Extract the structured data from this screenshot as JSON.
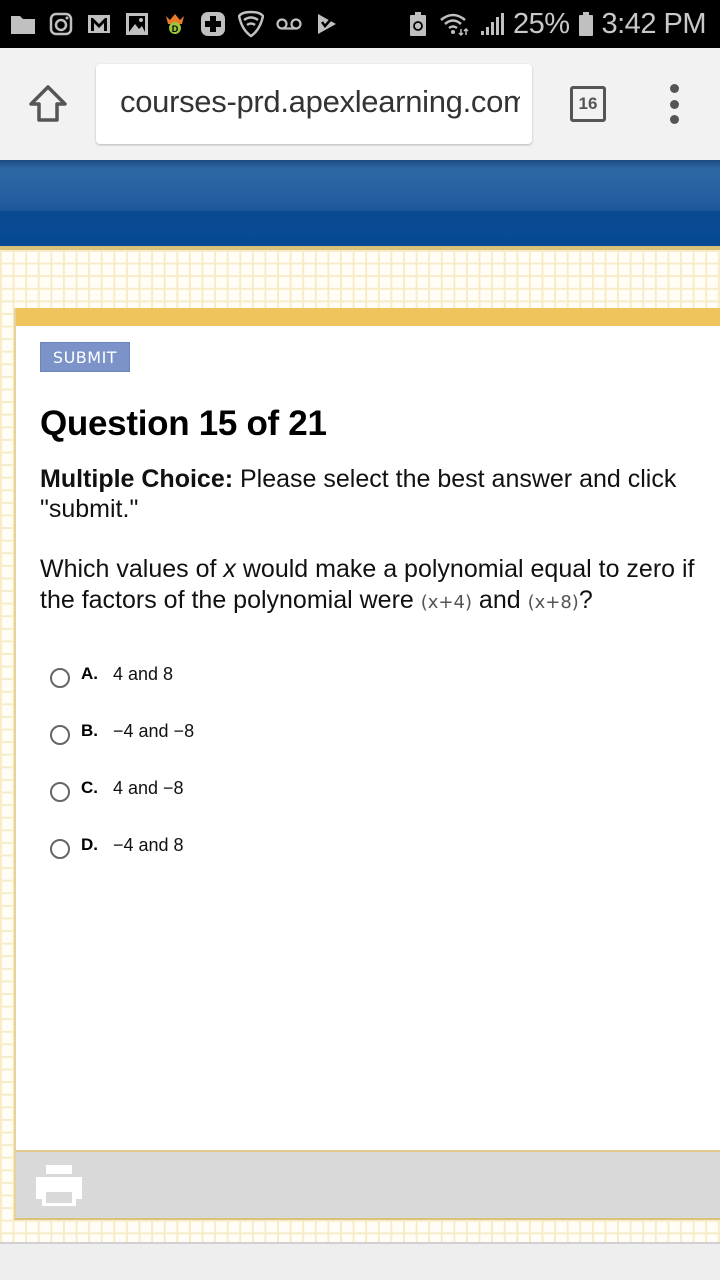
{
  "status_bar": {
    "left_icons": [
      "folder-icon",
      "instagram-icon",
      "gmail-icon",
      "gallery-icon",
      "draftkings-icon",
      "health-plus-icon",
      "vpn-shield-icon",
      "voicemail-icon",
      "task-check-icon"
    ],
    "right_icons": [
      "battery-saver-icon",
      "wifi-icon",
      "signal-icon"
    ],
    "battery": "25%",
    "time": "3:42 PM"
  },
  "browser": {
    "url": "courses-prd.apexlearning.com",
    "tab_count": "16"
  },
  "quiz": {
    "submit_label": "SUBMIT",
    "title": "Question 15 of 21",
    "instruction_bold": "Multiple Choice:",
    "instruction_rest": " Please select the best answer and click \"submit.\"",
    "question_part1": "Which values of ",
    "question_var": "x",
    "question_part2": " would make a polynomial equal to zero if the factors of the polynomial were ",
    "factor1": "(x+4)",
    "question_and": " and ",
    "factor2": "(x+8)",
    "question_end": "?",
    "choices": [
      {
        "letter": "A.",
        "text": "4 and 8"
      },
      {
        "letter": "B.",
        "text": "−4 and −8"
      },
      {
        "letter": "C.",
        "text": "4 and −8"
      },
      {
        "letter": "D.",
        "text": "−4 and 8"
      }
    ]
  },
  "colors": {
    "header_blue": "#0a4a92",
    "panel_gold": "#f0c45c",
    "submit_bg": "#7b93c9"
  }
}
